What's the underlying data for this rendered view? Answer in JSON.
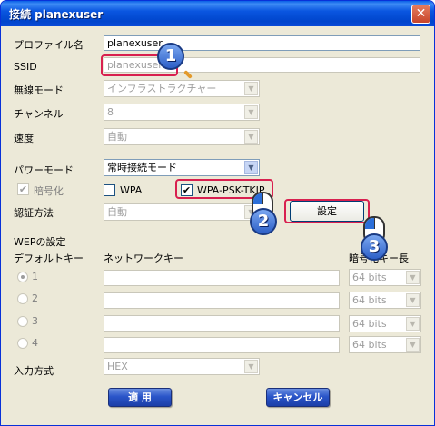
{
  "window": {
    "title": "接続 planexuser",
    "close_glyph": "✕"
  },
  "form": {
    "profile_label": "プロファイル名",
    "profile_value": "planexuser",
    "ssid_label": "SSID",
    "ssid_value": "planexuser",
    "wireless_mode_label": "無線モード",
    "wireless_mode_value": "インフラストラクチャー",
    "channel_label": "チャンネル",
    "channel_value": "8",
    "speed_label": "速度",
    "speed_value": "自動",
    "power_mode_label": "パワーモード",
    "power_mode_value": "常時接続モード",
    "encryption_label": "暗号化",
    "wpa_label": "WPA",
    "wpa_psk_label": "WPA-PSK-TKIP",
    "auth_label": "認証方法",
    "auth_value": "自動",
    "settings_button": "設定",
    "wep_heading": "WEPの設定",
    "default_key_header": "デフォルトキー",
    "network_key_header": "ネットワークキー",
    "key_length_header": "暗号化キー長",
    "wep_keys": [
      {
        "num": "1",
        "bits": "64 bits"
      },
      {
        "num": "2",
        "bits": "64 bits"
      },
      {
        "num": "3",
        "bits": "64 bits"
      },
      {
        "num": "4",
        "bits": "64 bits"
      }
    ],
    "input_method_label": "入力方式",
    "input_method_value": "HEX",
    "apply_button": "適 用",
    "cancel_button": "キャンセル"
  },
  "annotations": {
    "step1": "1",
    "step2": "2",
    "step3": "3",
    "highlight_color": "#d8204f"
  },
  "icons": {
    "checkmark": "✔",
    "dropdown_arrow": "▼"
  }
}
